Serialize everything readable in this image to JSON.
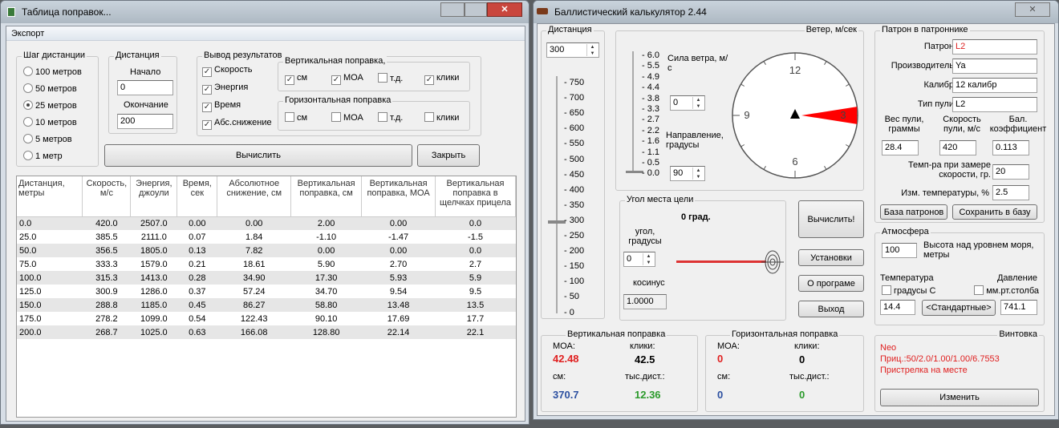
{
  "table_window": {
    "title": "Таблица поправок...",
    "menu": [
      "Экспорт"
    ],
    "step": {
      "legend": "Шаг дистанции",
      "options": [
        "100 метров",
        "50 метров",
        "25 метров",
        "10 метров",
        "5 метров",
        "1 метр"
      ],
      "selected": 2
    },
    "distance": {
      "legend": "Дистанция",
      "start_label": "Начало",
      "start": "0",
      "end_label": "Окончание",
      "end": "200"
    },
    "output": {
      "legend": "Вывод результатов",
      "items": [
        {
          "label": "Скорость",
          "checked": true
        },
        {
          "label": "Энергия",
          "checked": true
        },
        {
          "label": "Время",
          "checked": true
        },
        {
          "label": "Абс.снижение",
          "checked": true
        }
      ],
      "vertical": {
        "legend": "Вертикальная поправка,",
        "items": [
          {
            "label": "см",
            "checked": true
          },
          {
            "label": "МОА",
            "checked": true
          },
          {
            "label": "т.д.",
            "checked": false
          },
          {
            "label": "клики",
            "checked": true
          }
        ]
      },
      "horizontal": {
        "legend": "Горизонтальная поправка",
        "items": [
          {
            "label": "см",
            "checked": false
          },
          {
            "label": "МОА",
            "checked": false
          },
          {
            "label": "т.д.",
            "checked": false
          },
          {
            "label": "клики",
            "checked": false
          }
        ]
      }
    },
    "calc_button": "Вычислить",
    "close_button": "Закрыть",
    "columns": [
      "Дистанция, метры",
      "Скорость, м/с",
      "Энергия, джоули",
      "Время, сек",
      "Абсолютное снижение, см",
      "Вертикальная поправка, см",
      "Вертикальная поправка, МОА",
      "Вертикальная поправка в щелчках прицела"
    ],
    "rows": [
      [
        "0.0",
        "420.0",
        "2507.0",
        "0.00",
        "0.00",
        "2.00",
        "0.00",
        "0.0"
      ],
      [
        "25.0",
        "385.5",
        "2111.0",
        "0.07",
        "1.84",
        "-1.10",
        "-1.47",
        "-1.5"
      ],
      [
        "50.0",
        "356.5",
        "1805.0",
        "0.13",
        "7.82",
        "0.00",
        "0.00",
        "0.0"
      ],
      [
        "75.0",
        "333.3",
        "1579.0",
        "0.21",
        "18.61",
        "5.90",
        "2.70",
        "2.7"
      ],
      [
        "100.0",
        "315.3",
        "1413.0",
        "0.28",
        "34.90",
        "17.30",
        "5.93",
        "5.9"
      ],
      [
        "125.0",
        "300.9",
        "1286.0",
        "0.37",
        "57.24",
        "34.70",
        "9.54",
        "9.5"
      ],
      [
        "150.0",
        "288.8",
        "1185.0",
        "0.45",
        "86.27",
        "58.80",
        "13.48",
        "13.5"
      ],
      [
        "175.0",
        "278.2",
        "1099.0",
        "0.54",
        "122.43",
        "90.10",
        "17.69",
        "17.7"
      ],
      [
        "200.0",
        "268.7",
        "1025.0",
        "0.63",
        "166.08",
        "128.80",
        "22.14",
        "22.1"
      ]
    ]
  },
  "calc_window": {
    "title": "Баллистический калькулятор 2.44",
    "distance": {
      "legend": "Дистанция",
      "value": "300",
      "ticks": [
        "750",
        "700",
        "650",
        "600",
        "550",
        "500",
        "450",
        "400",
        "350",
        "300",
        "250",
        "200",
        "150",
        "100",
        "50",
        "0"
      ],
      "slider_value": 300
    },
    "wind": {
      "legend": "Ветер, м/сек",
      "ticks": [
        "6.0",
        "5.5",
        "4.9",
        "4.4",
        "3.8",
        "3.3",
        "2.7",
        "2.2",
        "1.6",
        "1.1",
        "0.5",
        "0.0"
      ],
      "slider_value": 0.0,
      "speed_label": "Сила ветра, м/с",
      "speed": "0",
      "dir_label": "Направление, градусы",
      "dir": "90",
      "clock": [
        "12",
        "3",
        "6",
        "9"
      ],
      "wind_color": "#ff0000"
    },
    "angle": {
      "legend": "Угол места цели",
      "value_text": "0 град.",
      "angle_label": "угол, градусы",
      "angle": "0",
      "cos_label": "косинус",
      "cos": "1.0000"
    },
    "buttons": {
      "calc": "Вычислить!",
      "settings": "Установки",
      "about": "О програме",
      "exit": "Выход"
    },
    "vertical": {
      "legend": "Вертикальная поправка",
      "moa_label": "МОА:",
      "moa": "42.48",
      "clicks_label": "клики:",
      "clicks": "42.5",
      "cm_label": "см:",
      "cm": "370.7",
      "mil_label": "тыс.дист.:",
      "mil": "12.36"
    },
    "horizontal": {
      "legend": "Горизонтальная поправка",
      "moa_label": "МОА:",
      "moa": "0",
      "clicks_label": "клики:",
      "clicks": "0",
      "cm_label": "см:",
      "cm": "0",
      "mil_label": "тыс.дист.:",
      "mil": "0"
    },
    "cartridge": {
      "legend": "Патрон в патроннике",
      "name_label": "Патрон",
      "name": "L2",
      "maker_label": "Производитель",
      "maker": "Ya",
      "caliber_label": "Калибр",
      "caliber": "12 калибр",
      "bullet_label": "Тип пули",
      "bullet": "L2",
      "weight_label": "Вес пули, граммы",
      "weight": "28.4",
      "speed_label": "Скорость пули, м/с",
      "speed": "420",
      "bc_label": "Бал. коэффициент",
      "bc": "0.113",
      "temp_label": "Темп-ра при замере скорости, гр.",
      "temp": "20",
      "tchange_label": "Изм. температуры, %",
      "tchange": "2.5",
      "db_button": "База патронов",
      "save_button": "Сохранить в базу"
    },
    "atmosphere": {
      "legend": "Атмосфера",
      "alt": "100",
      "alt_label": "Высота над уровнем моря, метры",
      "temp_label": "Температура",
      "temp_unit": "градусы С",
      "press_label": "Давление",
      "press_unit": "мм.рт.столба",
      "temp": "14.4",
      "std_button": "<Стандартные>",
      "press": "741.1"
    },
    "rifle": {
      "legend": "Винтовка",
      "lines": [
        "Neo",
        "Приц.:50/2.0/1.00/1.00/6.7553",
        "Пристрелка на месте"
      ],
      "change_button": "Изменить"
    },
    "colors": {
      "moa": "#e02020",
      "cm": "#2b4fa0",
      "mil": "#2a9a2a",
      "rifle_text": "#e02020"
    }
  }
}
